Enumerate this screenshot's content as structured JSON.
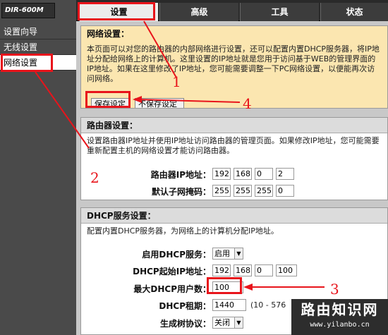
{
  "brand": {
    "model": "DIR-600M"
  },
  "sidebar": {
    "items": [
      {
        "label": "设置向导"
      },
      {
        "label": "无线设置"
      },
      {
        "label": "网络设置"
      }
    ]
  },
  "tabs": [
    {
      "label": "设置"
    },
    {
      "label": "高级"
    },
    {
      "label": "工具"
    },
    {
      "label": "状态"
    }
  ],
  "network": {
    "title": "网络设置：",
    "description": "本页面可以对您的路由器的内部网络进行设置，还可以配置内置DHCP服务器，将IP地\n址分配给网络上的计算机。这里设置的IP地址就是您用于访问基于WEB的管理界面的\nIP地址。如果在这里修改了IP地址，您可能需要调整一下PC网络设置，以便能再次访\n问网络。",
    "save_label": "保存设定",
    "nosave_label": "不保存设定"
  },
  "router": {
    "title": "路由器设置：",
    "description": "设置路由器IP地址并使用IP地址访问路由器的管理页面。如果修改IP地址，您可能需要\n重新配置主机的网络设置才能访问路由器。",
    "ip_label": "路由器IP地址：",
    "ip": [
      "192",
      "168",
      "0",
      "2"
    ],
    "mask_label": "默认子网掩码：",
    "mask": [
      "255",
      "255",
      "255",
      "0"
    ]
  },
  "dhcp": {
    "title": "DHCP服务设置：",
    "description": "配置内置DHCP服务器，为网络上的计算机分配IP地址。",
    "enable_label": "启用DHCP服务：",
    "enable_value": "启用",
    "start_label": "DHCP起始IP地址：",
    "start_ip": [
      "192",
      "168",
      "0",
      "100"
    ],
    "max_users_label": "最大DHCP用户数：",
    "max_users": "100",
    "lease_label": "DHCP租期：",
    "lease_value": "1440",
    "lease_hint": "(10 - 576",
    "stp_label": "生成树协议：",
    "stp_value": "关闭"
  },
  "annotations": {
    "n1": "1",
    "n2": "2",
    "n3": "3",
    "n4": "4",
    "color": "#e8141b"
  },
  "watermark": {
    "title": "路由知识网",
    "url": "www.yilanbo.cn"
  }
}
